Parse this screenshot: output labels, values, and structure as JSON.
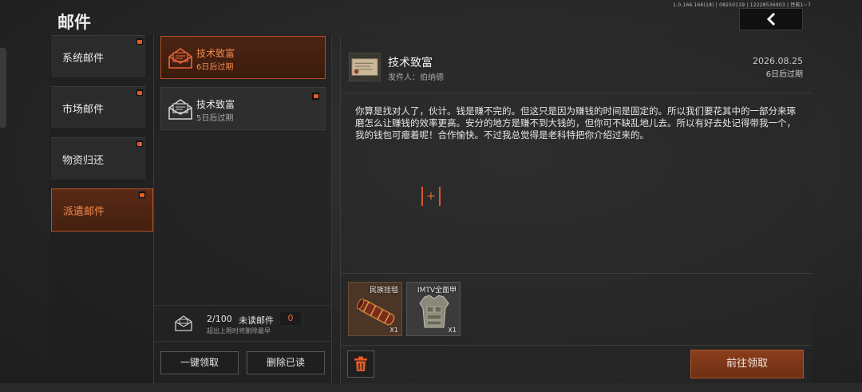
{
  "version": "1.0.166.166(18) | 08250119 | 12228536903 | 性能1~7",
  "header": {
    "title": "邮件",
    "back_icon": "chevron-left-icon"
  },
  "sidebar": {
    "items": [
      {
        "label": "系统邮件",
        "active": false
      },
      {
        "label": "市场邮件",
        "active": false
      },
      {
        "label": "物资归还",
        "active": false
      },
      {
        "label": "派遣邮件",
        "active": true
      }
    ]
  },
  "mail_list": {
    "items": [
      {
        "title": "技术致富",
        "subtitle": "6日后过期",
        "active": true,
        "icon": "open-envelope-icon"
      },
      {
        "title": "技术致富",
        "subtitle": "5日后过期",
        "active": false,
        "icon": "envelope-icon"
      }
    ],
    "count": "2/100",
    "unread_label": "未读邮件",
    "unread_count": "0",
    "note": "超出上限时将删除最早",
    "claim_all_label": "一键领取",
    "delete_read_label": "删除已读"
  },
  "detail": {
    "title": "技术致富",
    "sender": "发件人：伯纳德",
    "date": "2026.08.25",
    "expiry": "6日后过期",
    "body": "你算是找对人了，伙计。钱是赚不完的。但这只是因为赚钱的时间是固定的。所以我们要花其中的一部分来琢磨怎么让赚钱的效率更高。安分的地方是赚不到大钱的，但你可不缺乱地儿去。所以有好去处记得带我一个，我的钱包可瘪着呢！合作愉快。不过我总觉得是老科特把你介绍过来的。",
    "add_symbol": "+",
    "attachments": [
      {
        "name": "民族挂毯",
        "qty": "X1"
      },
      {
        "name": "IMTV全面甲",
        "qty": "X1"
      }
    ],
    "claim_label": "前往领取"
  },
  "colors": {
    "accent": "#e05a2a",
    "accent_dark": "#6e2f14"
  }
}
